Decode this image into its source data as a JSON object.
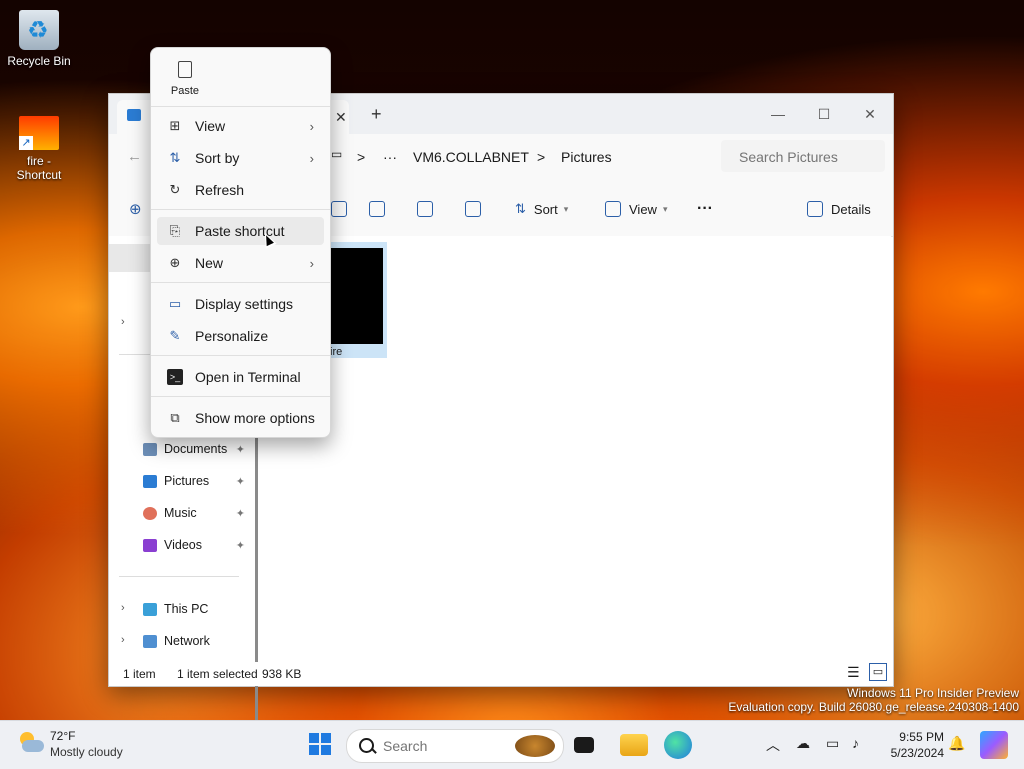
{
  "desktop": {
    "icons": [
      {
        "label": "Recycle Bin",
        "icon": "recycle-bin-icon"
      },
      {
        "label": "fire - Shortcut",
        "icon": "shortcut-icon"
      }
    ],
    "watermark": {
      "line1": "Windows 11 Pro Insider Preview",
      "line2": "Evaluation copy. Build 26080.ge_release.240308-1400"
    }
  },
  "explorer": {
    "tab_close": "✕",
    "tab_new": "+",
    "controls": {
      "minimize": "—",
      "maximize": "☐",
      "close": "✕"
    },
    "breadcrumb": {
      "ellipsis": "···",
      "items": [
        "VM6.COLLABNET",
        "Pictures"
      ],
      "separator": ">"
    },
    "search_placeholder": "Search Pictures",
    "toolbar": {
      "sort": "Sort",
      "view": "View",
      "more": "···",
      "details": "Details"
    },
    "nav": {
      "pinned": [
        {
          "label": "Documents",
          "color": "#6d8fb8"
        },
        {
          "label": "Pictures",
          "color": "#2b7cd3"
        },
        {
          "label": "Music",
          "color": "#e0705a"
        },
        {
          "label": "Videos",
          "color": "#8a3fd1"
        }
      ],
      "pin_glyph": "📌",
      "this_pc": "This PC",
      "network": "Network"
    },
    "file": {
      "name": "fire"
    },
    "status": {
      "count": "1 item",
      "selected": "1 item selected",
      "size": "938 KB"
    }
  },
  "context_menu": {
    "paste": "Paste",
    "items": [
      {
        "label": "View",
        "icon": "grid-icon",
        "submenu": true
      },
      {
        "label": "Sort by",
        "icon": "sort-icon",
        "submenu": true
      },
      {
        "label": "Refresh",
        "icon": "refresh-icon",
        "submenu": false
      },
      {
        "label": "Paste shortcut",
        "icon": "paste-shortcut-icon",
        "submenu": false
      },
      {
        "label": "New",
        "icon": "new-icon",
        "submenu": true
      },
      {
        "label": "Display settings",
        "icon": "display-icon",
        "submenu": false
      },
      {
        "label": "Personalize",
        "icon": "brush-icon",
        "submenu": false
      },
      {
        "label": "Open in Terminal",
        "icon": "terminal-icon",
        "submenu": false
      },
      {
        "label": "Show more options",
        "icon": "more-options-icon",
        "submenu": false
      }
    ]
  },
  "taskbar": {
    "weather": {
      "temp": "72°F",
      "condition": "Mostly cloudy"
    },
    "search_placeholder": "Search",
    "clock": {
      "time": "9:55 PM",
      "date": "5/23/2024"
    }
  },
  "colors": {
    "accent": "#1f7ae0",
    "selection": "#cce4f7"
  }
}
